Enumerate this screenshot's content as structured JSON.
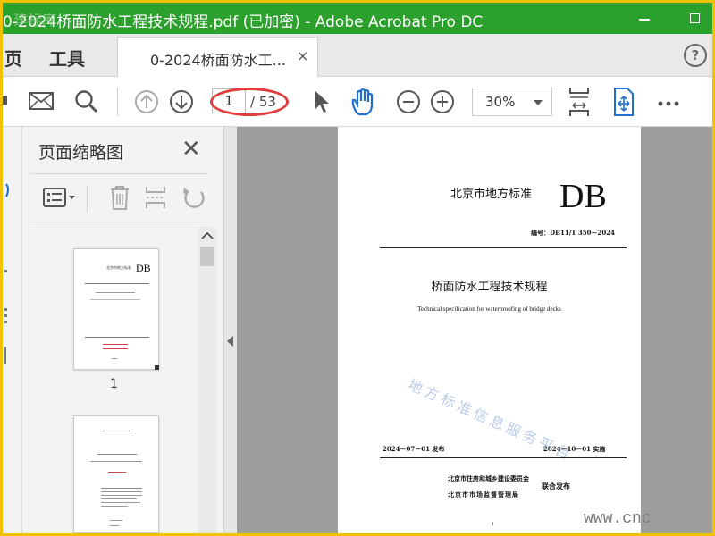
{
  "window": {
    "title": "0-2024桥面防水工程技术规程.pdf  (已加密)  - Adobe Acrobat Pro DC",
    "corner_watermark": "建标库"
  },
  "nav": {
    "home_partial": "页",
    "tools": "工具",
    "doc_tab": "0-2024桥面防水工...",
    "doc_tab_close": "×",
    "help": "?"
  },
  "toolbar": {
    "current_page": "1",
    "total_pages": "/ 53",
    "zoom": "30%"
  },
  "thumbnails_panel": {
    "title": "页面缩略图",
    "close": "✕",
    "page_1_number": "1",
    "thumb_db": "DB",
    "thumb_auth": "北京市地方标准"
  },
  "document_page": {
    "authority": "北京市地方标准",
    "db_mark": "DB",
    "code": "编号：DB11/T 350－2024",
    "title_cn": "桥面防水工程技术规程",
    "title_en": "Technical specification for waterproofing of bridge decks",
    "publish_date": "2024－07－01 发布",
    "implement_date": "2024－10－01 实施",
    "issuer_1": "北京市住房和城乡建设委员会",
    "issuer_2": "北京市市场监督管理局",
    "joint_issue": "联合发布",
    "page_number": "1",
    "watermark": "地方标准信息服务平台"
  },
  "site_watermark": "www.cnc"
}
